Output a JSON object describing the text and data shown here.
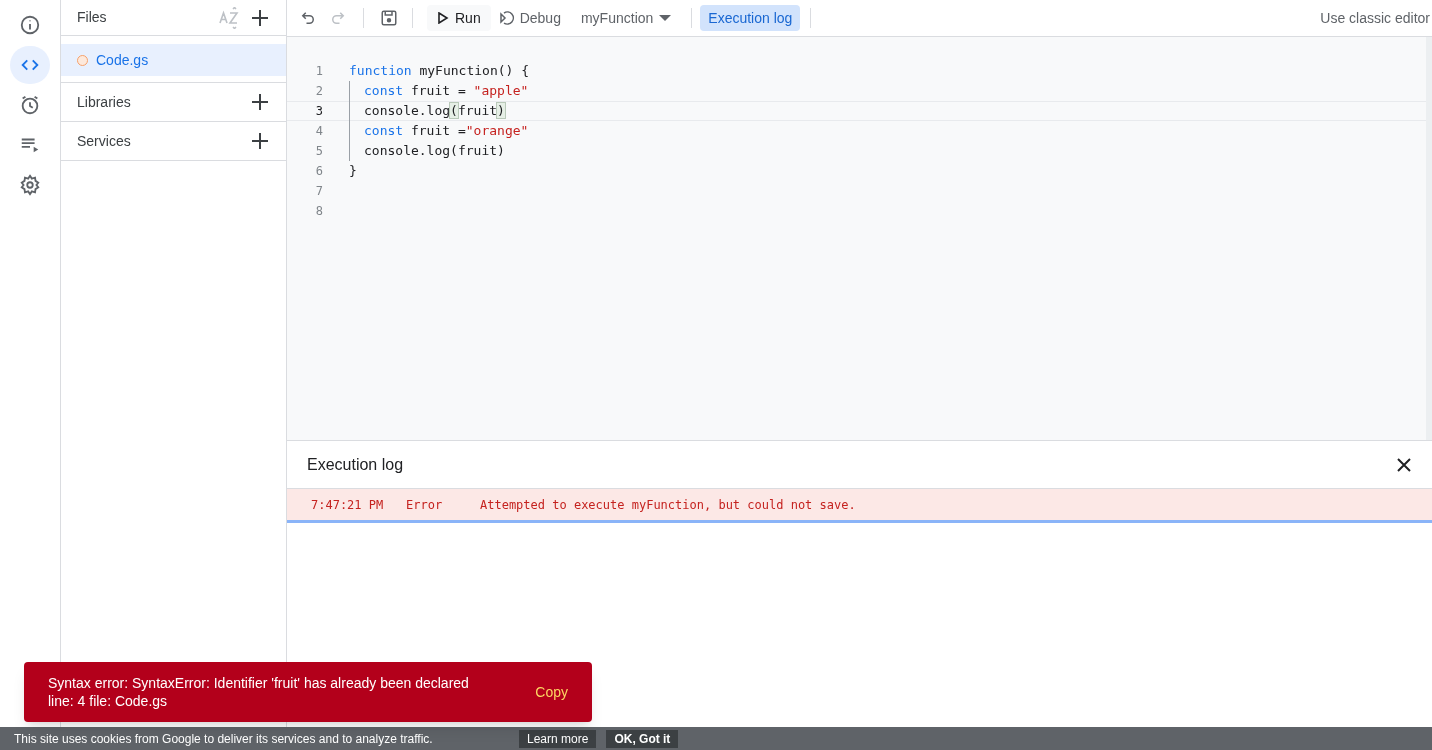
{
  "rail": [
    {
      "selected": false
    },
    {
      "selected": true
    },
    {
      "selected": false
    },
    {
      "selected": false
    },
    {
      "selected": false
    }
  ],
  "files_panel": {
    "title": "Files",
    "files": [
      {
        "name": "Code.gs",
        "selected": true
      }
    ],
    "sections": [
      "Libraries",
      "Services"
    ]
  },
  "toolbar": {
    "run": "Run",
    "debug": "Debug",
    "function": "myFunction",
    "execution_log": {
      "label": "Execution log",
      "selected": true
    },
    "classic": "Use classic editor"
  },
  "editor": {
    "lines": [
      {
        "number": "1",
        "selected": false,
        "indent": false,
        "tokens": [
          {
            "kind": "keyword",
            "text": "function"
          },
          {
            "kind": "plain",
            "text": " myFunction() {"
          }
        ]
      },
      {
        "number": "2",
        "selected": false,
        "indent": true,
        "tokens": [
          {
            "kind": "keyword",
            "text": "const"
          },
          {
            "kind": "plain",
            "text": " fruit = "
          },
          {
            "kind": "string",
            "text": "\"apple\""
          }
        ]
      },
      {
        "number": "3",
        "selected": true,
        "indent": true,
        "tokens": [
          {
            "kind": "plain",
            "text": "console.log"
          },
          {
            "kind": "match",
            "text": "("
          },
          {
            "kind": "plain",
            "text": "fruit"
          },
          {
            "kind": "match",
            "text": ")"
          }
        ]
      },
      {
        "number": "4",
        "selected": false,
        "indent": true,
        "tokens": [
          {
            "kind": "keyword",
            "text": "const"
          },
          {
            "kind": "plain",
            "text": " fruit ="
          },
          {
            "kind": "string",
            "text": "\"orange\""
          }
        ]
      },
      {
        "number": "5",
        "selected": false,
        "indent": true,
        "tokens": [
          {
            "kind": "plain",
            "text": "console.log(fruit)"
          }
        ]
      },
      {
        "number": "6",
        "selected": false,
        "indent": false,
        "tokens": [
          {
            "kind": "plain",
            "text": "}"
          }
        ]
      },
      {
        "number": "7",
        "selected": false
      },
      {
        "number": "8",
        "selected": false
      }
    ]
  },
  "execution_log": {
    "title": "Execution log",
    "entries": [
      {
        "time": "7:47:21 PM",
        "level": "Error",
        "message": "Attempted to execute myFunction, but could not save."
      }
    ]
  },
  "toast": {
    "message": "Syntax error: SyntaxError: Identifier 'fruit' has already been declared line: 4 file: Code.gs",
    "action": "Copy"
  },
  "cookie_bar": {
    "text": "This site uses cookies from Google to deliver its services and to analyze traffic.",
    "learn_more": "Learn more",
    "ok": "OK, Got it"
  }
}
